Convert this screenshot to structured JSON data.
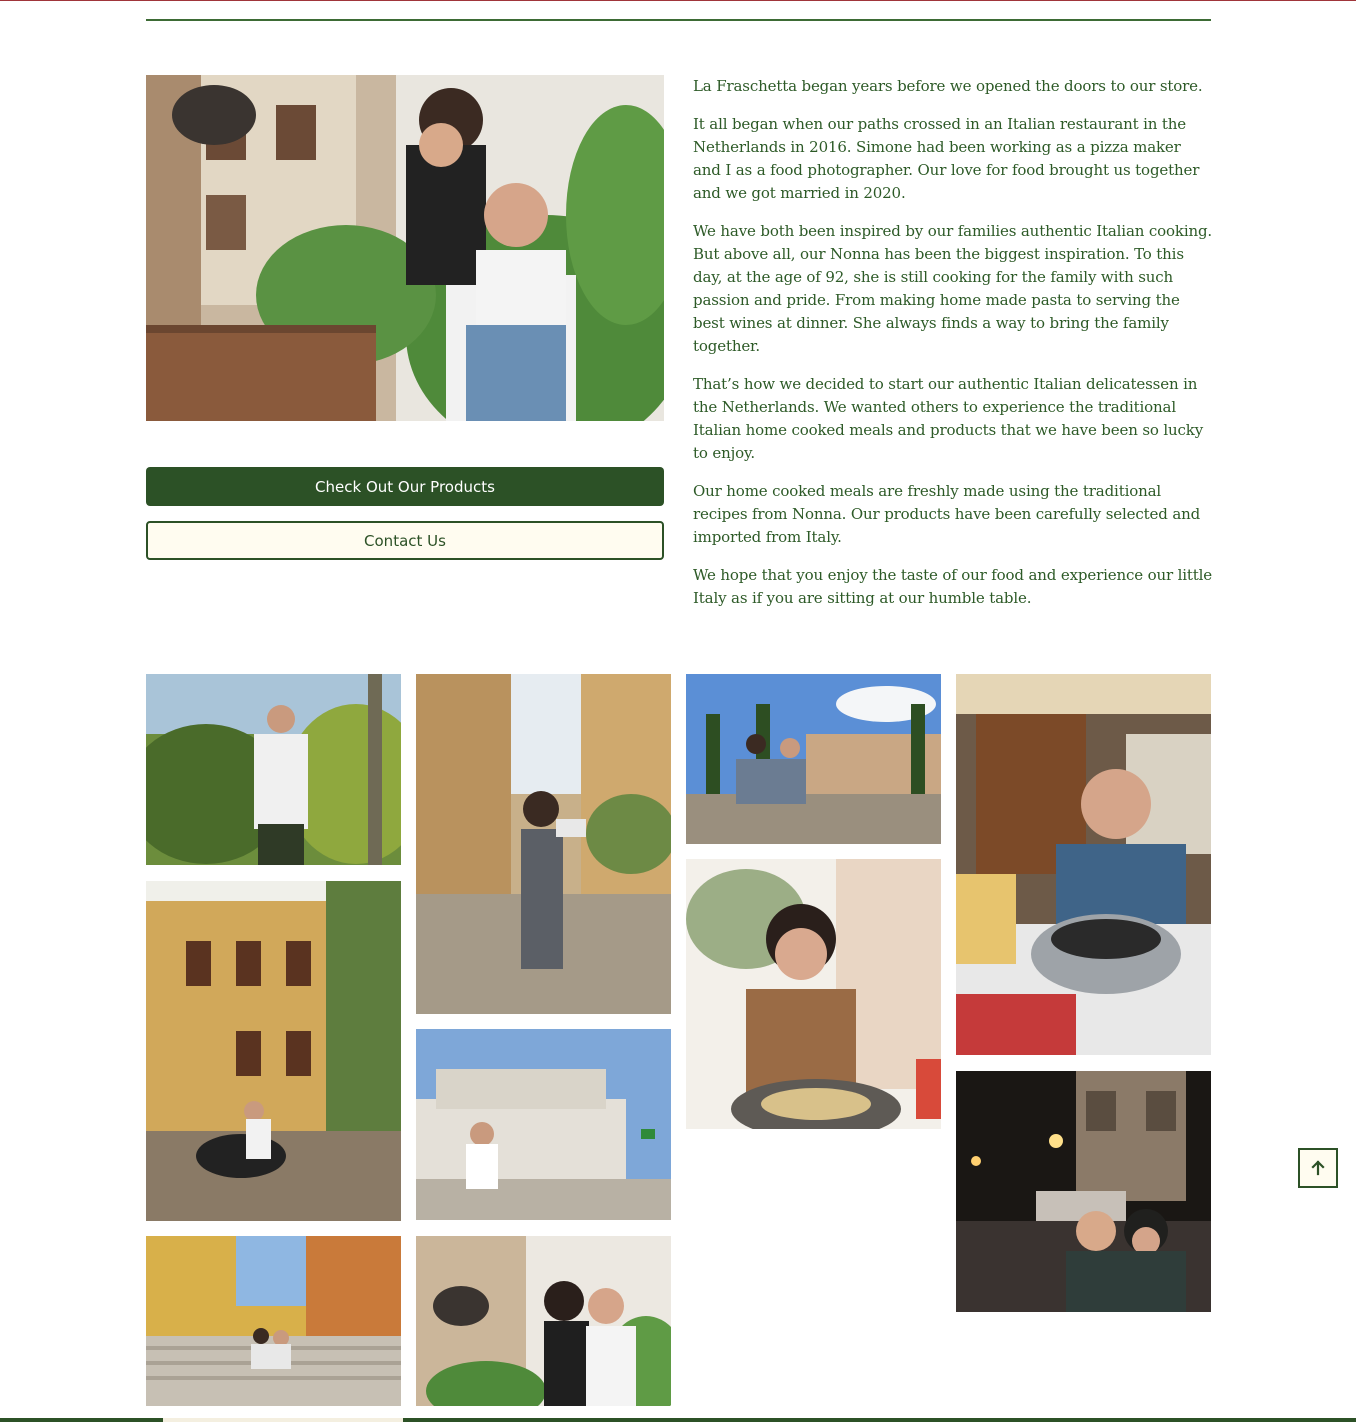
{
  "hero": {
    "image_alt": "Couple sitting by a stone well in an Italian courtyard",
    "primary_button": "Check Out Our Products",
    "secondary_button": "Contact Us"
  },
  "story": {
    "paragraphs": [
      "La Fraschetta began years before we opened the doors to our store.",
      "It all began when our paths crossed in an Italian restaurant in the Netherlands in 2016. Simone had been working as a pizza maker and I as a food photographer. Our love for food brought us together and we got married in 2020.",
      "We have both been inspired by our families authentic Italian cooking. But above all, our Nonna has been the biggest inspiration. To this day, at the age of 92, she is still cooking for the family with such passion and pride. From making home made pasta to serving the best wines at dinner. She always finds a way to bring the family together.",
      "That’s how we decided to start our authentic Italian delicatessen in the Netherlands. We wanted others to experience the traditional Italian home cooked meals and products that we have been so lucky to enjoy.",
      "Our home cooked meals are freshly made using the traditional recipes from Nonna. Our products have been carefully selected and imported from Italy.",
      "We hope that you enjoy the taste of our food and experience our little Italy as if you are sitting at our humble table."
    ]
  },
  "gallery": [
    {
      "name": "gallery-photo-vineyard"
    },
    {
      "name": "gallery-photo-street-walk"
    },
    {
      "name": "gallery-photo-colosseum"
    },
    {
      "name": "gallery-photo-restaurant-mussels"
    },
    {
      "name": "gallery-photo-scooter"
    },
    {
      "name": "gallery-photo-vittoriano"
    },
    {
      "name": "gallery-photo-pasta"
    },
    {
      "name": "gallery-photo-night-church"
    },
    {
      "name": "gallery-photo-stairs"
    },
    {
      "name": "gallery-photo-well-couple"
    }
  ],
  "icons": {
    "back_to_top": "arrow-up-icon"
  },
  "colors": {
    "brand_green": "#2c5126",
    "cream": "#fffcf0",
    "accent_red": "#a0353a"
  }
}
